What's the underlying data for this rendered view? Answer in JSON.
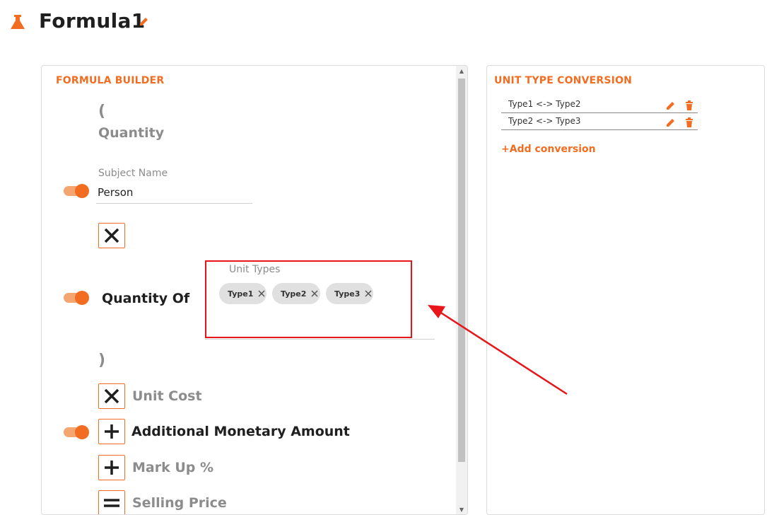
{
  "header": {
    "title": "Formula1",
    "icon": "flask-icon",
    "accent": "#f26d21"
  },
  "builder": {
    "section_title": "FORMULA BUILDER",
    "open_paren": "(",
    "close_paren": ")",
    "quantity_label": "Quantity",
    "subject": {
      "label": "Subject Name",
      "value": "Person",
      "toggle_on": true
    },
    "quantity_of": {
      "label": "Quantity Of",
      "toggle_on": true
    },
    "unit_types": {
      "label": "Unit Types",
      "chips": [
        "Type1",
        "Type2",
        "Type3"
      ]
    },
    "terms": [
      {
        "operator": "times",
        "label": "Unit Cost",
        "active": false
      },
      {
        "operator": "plus",
        "label": "Additional Monetary Amount",
        "active": true
      },
      {
        "operator": "plus",
        "label": "Mark Up %",
        "active": false
      },
      {
        "operator": "equals",
        "label": "Selling Price",
        "active": false
      }
    ]
  },
  "conversion": {
    "section_title": "UNIT TYPE CONVERSION",
    "rows": [
      {
        "label": "Type1 <-> Type2"
      },
      {
        "label": "Type2 <-> Type3"
      }
    ],
    "add_label": "+Add conversion"
  },
  "colors": {
    "accent": "#f26d21",
    "toggle_track": "#f5a56f",
    "annotation": "#e8161a"
  }
}
